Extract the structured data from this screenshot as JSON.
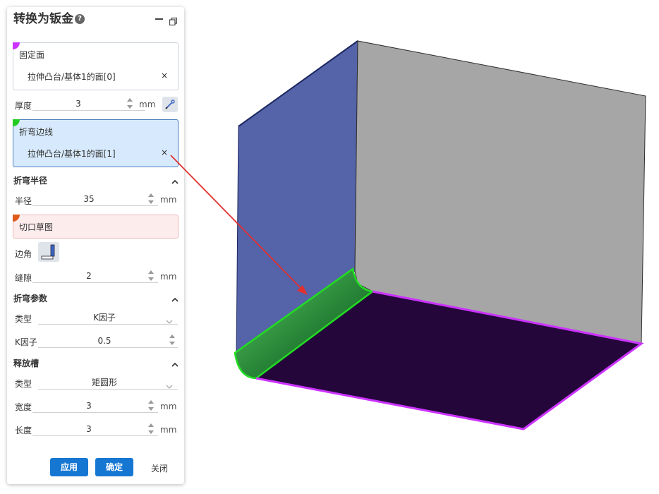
{
  "panel": {
    "title": "转换为钣金",
    "help_icon": "?",
    "fixed_face": {
      "label": "固定面",
      "value": "拉伸凸台/基体1的面[0]",
      "remove": "×",
      "color": "#cc33ff"
    },
    "thickness": {
      "label": "厚度",
      "value": "3",
      "unit": "mm"
    },
    "bend_edges": {
      "label": "折弯边线",
      "value": "拉伸凸台/基体1的面[1]",
      "remove": "×",
      "color": "#22cc22"
    },
    "bend_radius_section": {
      "title": "折弯半径",
      "caret": "^"
    },
    "radius": {
      "label": "半径",
      "value": "35",
      "unit": "mm"
    },
    "cut_sketch": {
      "label": "切口草图",
      "color": "#e05a1a"
    },
    "corner": {
      "label": "边角"
    },
    "gap": {
      "label": "缝隙",
      "value": "2",
      "unit": "mm"
    },
    "bend_params_section": {
      "title": "折弯参数",
      "caret": "^"
    },
    "bend_type": {
      "label": "类型",
      "value": "K因子"
    },
    "k_factor": {
      "label": "K因子",
      "value": "0.5"
    },
    "relief_section": {
      "title": "释放槽",
      "caret": "^"
    },
    "relief_type": {
      "label": "类型",
      "value": "矩圆形"
    },
    "width": {
      "label": "宽度",
      "value": "3",
      "unit": "mm"
    },
    "length": {
      "label": "长度",
      "value": "3",
      "unit": "mm"
    },
    "buttons": {
      "apply": "应用",
      "ok": "确定",
      "close": "关闭"
    }
  },
  "colors": {
    "accent": "#1677d2",
    "left_face": "#5563a8",
    "right_face": "#a6a6a6",
    "bottom_face": "#24063b",
    "bend_highlight": "#22dd22",
    "bottom_edge": "#cc33ff",
    "arrow": "#e03030"
  }
}
